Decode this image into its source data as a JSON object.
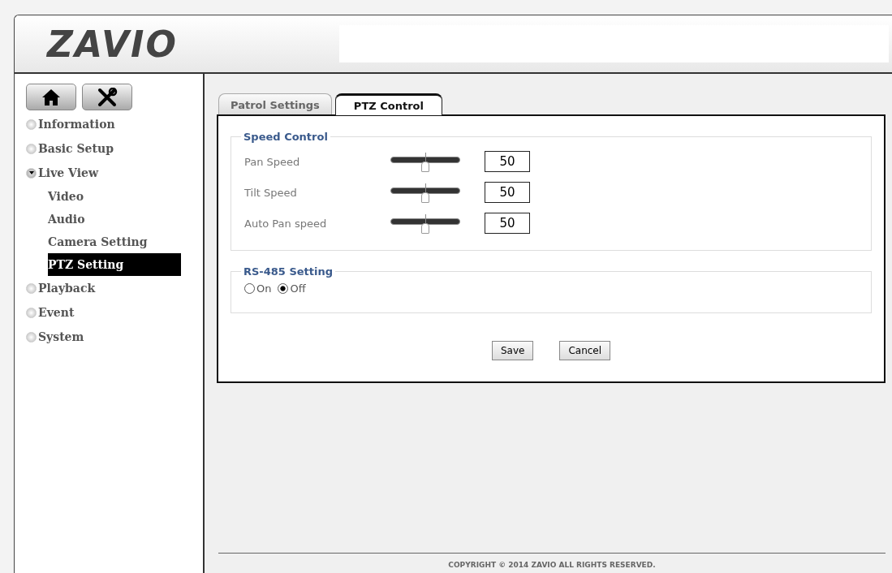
{
  "logo": "ZAVIO",
  "sidebar": {
    "items": [
      {
        "label": "Information",
        "expanded": false
      },
      {
        "label": "Basic Setup",
        "expanded": false
      },
      {
        "label": "Live View",
        "expanded": true,
        "children": [
          {
            "label": "Video",
            "selected": false
          },
          {
            "label": "Audio",
            "selected": false
          },
          {
            "label": "Camera Setting",
            "selected": false
          },
          {
            "label": "PTZ Setting",
            "selected": true
          }
        ]
      },
      {
        "label": "Playback",
        "expanded": false
      },
      {
        "label": "Event",
        "expanded": false
      },
      {
        "label": "System",
        "expanded": false
      }
    ]
  },
  "tabs": [
    {
      "label": "Patrol Settings",
      "selected": false
    },
    {
      "label": "PTZ Control",
      "selected": true
    }
  ],
  "speed_control": {
    "title": "Speed Control",
    "rows": [
      {
        "label": "Pan Speed",
        "level": 0.5,
        "value": "50"
      },
      {
        "label": "Tilt Speed",
        "level": 0.5,
        "value": "50"
      },
      {
        "label": "Auto Pan speed",
        "level": 0.5,
        "value": "50"
      }
    ]
  },
  "rs485": {
    "title": "RS-485 Setting",
    "options": [
      {
        "label": "On",
        "selected": false
      },
      {
        "label": "Off",
        "selected": true
      }
    ]
  },
  "buttons": [
    "Save",
    "Cancel"
  ],
  "footer": "COPYRIGHT © 2014 ZAVIO ALL RIGHTS RESERVED."
}
